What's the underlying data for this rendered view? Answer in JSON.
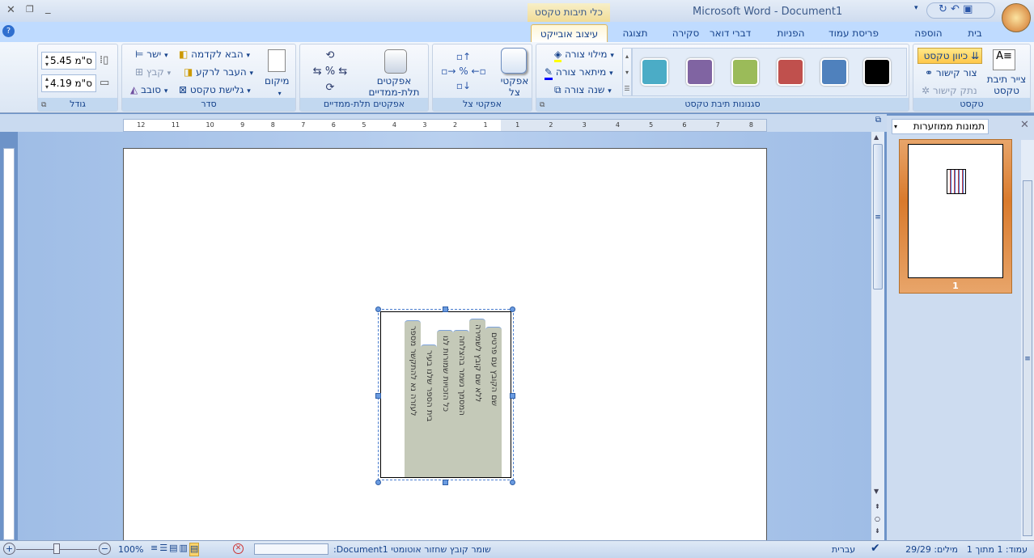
{
  "window": {
    "title": "Microsoft Word - Document1",
    "contextual_tab_group": "כלי תיבות טקסט"
  },
  "tabs": [
    {
      "label": "בית"
    },
    {
      "label": "הוספה"
    },
    {
      "label": "פריסת עמוד"
    },
    {
      "label": "הפניות"
    },
    {
      "label": "דברי דואר"
    },
    {
      "label": "סקירה"
    },
    {
      "label": "תצוגה"
    },
    {
      "label": "עיצוב אובייקט",
      "active": true
    }
  ],
  "ribbon": {
    "text_group": {
      "label": "טקסט",
      "draw_textbox": "צייר תיבת טקסט",
      "text_direction": "כיוון טקסט",
      "create_link": "צור קישור",
      "break_link": "נתק קישור"
    },
    "styles_group": {
      "label": "סגנונות תיבת טקסט",
      "swatches": [
        "#000000",
        "#4f81bd",
        "#c0504d",
        "#9bbb59",
        "#8064a2",
        "#4bacc6"
      ],
      "shape_fill": "מילוי צורה",
      "shape_outline": "מיתאר צורה",
      "change_shape": "שנה צורה"
    },
    "shadow_group": {
      "label": "אפקטי צל",
      "shadow_effects": "אפקטי צל"
    },
    "threed_group": {
      "label": "אפקטים תלת-ממדיים",
      "threed_effects": "אפקטים תלת-ממדיים"
    },
    "arrange_group": {
      "label": "סדר",
      "position": "מיקום",
      "bring_forward": "הבא לקדמה",
      "send_backward": "העבר לרקע",
      "text_wrapping": "גלישת טקסט",
      "align": "ישר",
      "group": "קבץ",
      "rotate": "סובב"
    },
    "size_group": {
      "label": "גודל",
      "height": "5.45 ס\"מ",
      "width": "4.19 ס\"מ"
    }
  },
  "ruler": {
    "left": [
      "12",
      "11",
      "10",
      "9",
      "8",
      "7",
      "6",
      "5",
      "4",
      "3",
      "2",
      "1"
    ],
    "right": [
      "1",
      "2",
      "3",
      "4",
      "5",
      "6",
      "7",
      "8"
    ]
  },
  "textbox": {
    "columns": [
      "לעזרה נא להתקשר מספר",
      "בית הספר שלנו בעיר",
      "כל הזכויות שמורות לנו",
      "המסמך נשמר בהצלחה",
      "ללא שם קובץ לשמירה",
      "שם הקובץ עם פרטים"
    ]
  },
  "thumbnails": {
    "dropdown": "תמונות ממוזערות",
    "page_number": "1"
  },
  "status": {
    "page": "עמוד: 1 מתוך 1",
    "words": "מילים: 29/29",
    "language": "עברית",
    "autosave": "שומר קובץ שחזור אוטומטי Document1:",
    "zoom": "100%"
  }
}
